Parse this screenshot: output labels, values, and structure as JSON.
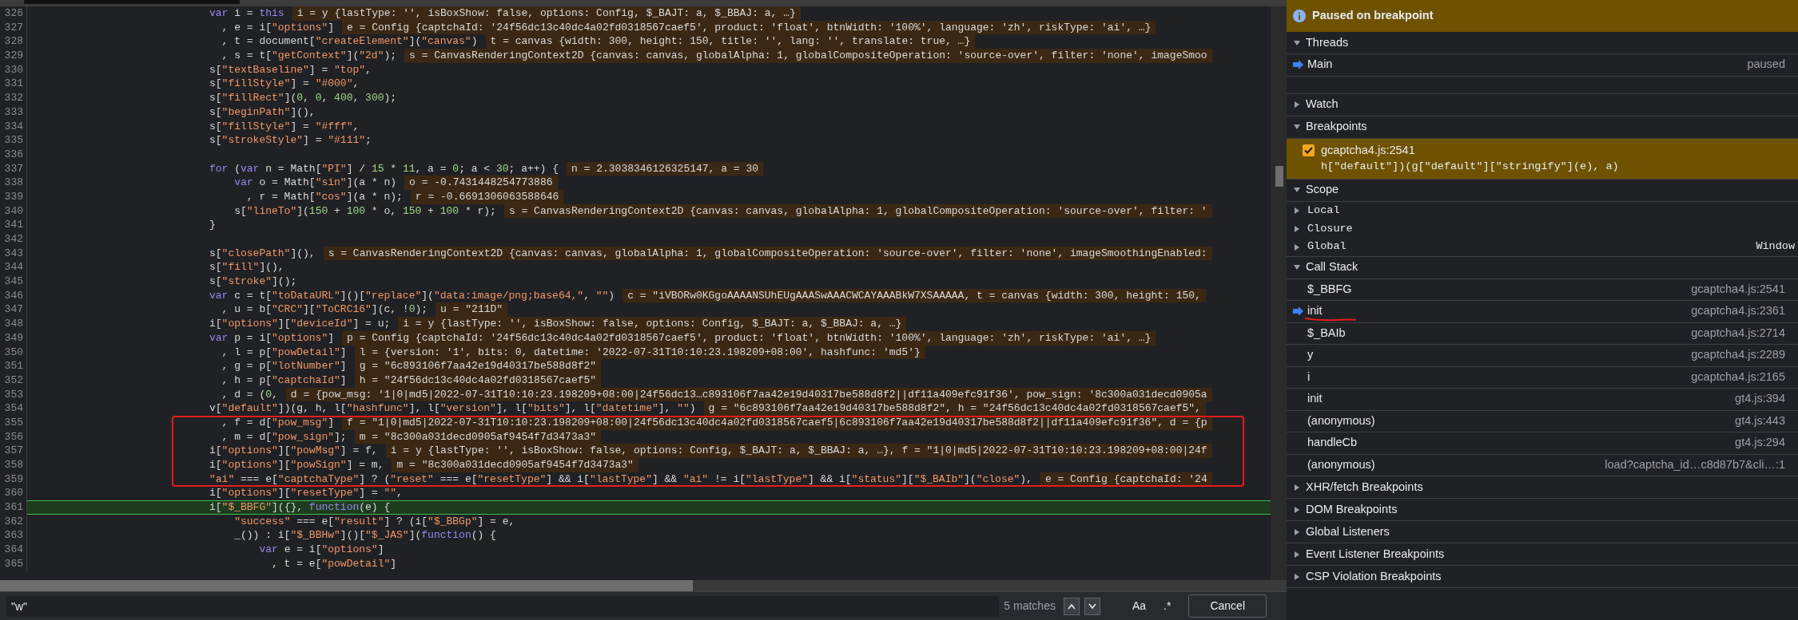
{
  "editor": {
    "lines": [
      {
        "number": "326",
        "code": "var i = this",
        "value": "i = y {lastType: '', isBoxShow: false, options: Config, $_BAJT: a, $_BBAJ: a, …}",
        "current": false
      },
      {
        "number": "327",
        "code": "  , e = i[\"options\"]",
        "value": "e = Config {captchaId: '24f56dc13c40dc4a02fd0318567caef5', product: 'float', btnWidth: '100%', language: 'zh', riskType: 'ai', …}",
        "current": false
      },
      {
        "number": "328",
        "code": "  , t = document[\"createElement\"](\"canvas\")",
        "value": "t = canvas {width: 300, height: 150, title: '', lang: '', translate: true, …}",
        "current": false
      },
      {
        "number": "329",
        "code": "  , s = t[\"getContext\"](\"2d\");",
        "value": "s = CanvasRenderingContext2D {canvas: canvas, globalAlpha: 1, globalCompositeOperation: 'source-over', filter: 'none', imageSmoo",
        "current": false
      },
      {
        "number": "330",
        "code": "s[\"textBaseline\"] = \"top\",",
        "current": false
      },
      {
        "number": "331",
        "code": "s[\"fillStyle\"] = \"#000\",",
        "current": false
      },
      {
        "number": "332",
        "code": "s[\"fillRect\"](0, 0, 400, 300);",
        "current": false
      },
      {
        "number": "333",
        "code": "s[\"beginPath\"](),",
        "current": false
      },
      {
        "number": "334",
        "code": "s[\"fillStyle\"] = \"#fff\",",
        "current": false
      },
      {
        "number": "335",
        "code": "s[\"strokeStyle\"] = \"#111\";",
        "current": false
      },
      {
        "number": "336",
        "current": false
      },
      {
        "number": "337",
        "code": "for (var n = Math[\"PI\"] / 15 * 11, a = 0; a < 30; a++) {",
        "value": "n = 2.3038346126325147, a = 30",
        "current": false
      },
      {
        "number": "338",
        "code": "    var o = Math[\"sin\"](a * n)",
        "value": "o = -0.7431448254773886",
        "current": false
      },
      {
        "number": "339",
        "code": "      , r = Math[\"cos\"](a * n);",
        "value": "r = -0.6691306063588646",
        "current": false
      },
      {
        "number": "340",
        "code": "    s[\"lineTo\"](150 + 100 * o, 150 + 100 * r);",
        "value": "s = CanvasRenderingContext2D {canvas: canvas, globalAlpha: 1, globalCompositeOperation: 'source-over', filter: '",
        "current": false
      },
      {
        "number": "341",
        "code": "}",
        "current": false
      },
      {
        "number": "342",
        "current": false
      },
      {
        "number": "343",
        "code": "s[\"closePath\"](),",
        "value": "s = CanvasRenderingContext2D {canvas: canvas, globalAlpha: 1, globalCompositeOperation: 'source-over', filter: 'none', imageSmoothingEnabled:",
        "current": false
      },
      {
        "number": "344",
        "code": "s[\"fill\"](),",
        "current": false
      },
      {
        "number": "345",
        "code": "s[\"stroke\"]();",
        "current": false
      },
      {
        "number": "346",
        "code": "var c = t[\"toDataURL\"]()[\"replace\"](\"data:image/png;base64,\", \"\")",
        "value": "c = \"iVBORw0KGgoAAAANSUhEUgAAASwAAACWCAYAAABkW7XSAAAAA, t = canvas {width: 300, height: 150,",
        "current": false
      },
      {
        "number": "347",
        "code": "  , u = b[\"CRC\"][\"ToCRC16\"](c, !0);",
        "value": "u = \"211D\"",
        "current": false
      },
      {
        "number": "348",
        "code": "i[\"options\"][\"deviceId\"] = u;",
        "value": "i = y {lastType: '', isBoxShow: false, options: Config, $_BAJT: a, $_BBAJ: a, …}",
        "current": false
      },
      {
        "number": "349",
        "code": "var p = i[\"options\"]",
        "value": "p = Config {captchaId: '24f56dc13c40dc4a02fd0318567caef5', product: 'float', btnWidth: '100%', language: 'zh', riskType: 'ai', …}",
        "current": false
      },
      {
        "number": "350",
        "code": "  , l = p[\"powDetail\"]",
        "value": "l = {version: '1', bits: 0, datetime: '2022-07-31T10:10:23.198209+08:00', hashfunc: 'md5'}",
        "current": false
      },
      {
        "number": "351",
        "code": "  , g = p[\"lotNumber\"]",
        "value": "g = \"6c893106f7aa42e19d40317be588d8f2\"",
        "current": false
      },
      {
        "number": "352",
        "code": "  , h = p[\"captchaId\"]",
        "value": "h = \"24f56dc13c40dc4a02fd0318567caef5\"",
        "current": false
      },
      {
        "number": "353",
        "code": "  , d = (0,",
        "value": "d = {pow_msg: '1|0|md5|2022-07-31T10:10:23.198209+08:00|24f56dc13…c893106f7aa42e19d40317be588d8f2||df11a409efc91f36', pow_sign: '8c300a031decd0905a",
        "current": false
      },
      {
        "number": "354",
        "code": "v[\"default\"])(g, h, l[\"hashfunc\"], l[\"version\"], l[\"bits\"], l[\"datetime\"], \"\")",
        "value": "g = \"6c893106f7aa42e19d40317be588d8f2\", h = \"24f56dc13c40dc4a02fd0318567caef5\",",
        "current": false
      },
      {
        "number": "355",
        "code": "  , f = d[\"pow_msg\"]",
        "value": "f = \"1|0|md5|2022-07-31T10:10:23.198209+08:00|24f56dc13c40dc4a02fd0318567caef5|6c893106f7aa42e19d40317be588d8f2||df11a409efc91f36\", d = {p",
        "current": false
      },
      {
        "number": "356",
        "code": "  , m = d[\"pow_sign\"];",
        "value": "m = \"8c300a031decd0905af9454f7d3473a3\"",
        "current": false
      },
      {
        "number": "357",
        "code": "i[\"options\"][\"powMsg\"] = f,",
        "value": "i = y {lastType: '', isBoxShow: false, options: Config, $_BAJT: a, $_BBAJ: a, …}, f = \"1|0|md5|2022-07-31T10:10:23.198209+08:00|24f",
        "current": false
      },
      {
        "number": "358",
        "code": "i[\"options\"][\"powSign\"] = m,",
        "value": "m = \"8c300a031decd0905af9454f7d3473a3\"",
        "current": false
      },
      {
        "number": "359",
        "code": "\"ai\" === e[\"captchaType\"] ? (\"reset\" === e[\"resetType\"] && i[\"lastType\"] && \"ai\" != i[\"lastType\"] && i[\"status\"][\"$_BAIb\"](\"close\"),",
        "value": "e = Config {captchaId: '24",
        "current": false
      },
      {
        "number": "360",
        "code": "i[\"options\"][\"resetType\"] = \"\",",
        "current": false
      },
      {
        "number": "361",
        "code": "i[\"$_BBFG\"]({}, function(e) {",
        "current": true
      },
      {
        "number": "362",
        "code": "    \"success\" === e[\"result\"] ? (i[\"$_BBGp\"] = e,",
        "current": false
      },
      {
        "number": "363",
        "code": "    _()) : i[\"$_BBHw\"]()[\"$_JAS\"](function() {",
        "current": false
      },
      {
        "number": "364",
        "code": "        var e = i[\"options\"]",
        "current": false
      },
      {
        "number": "365",
        "code": "          , t = e[\"powDetail\"]",
        "current": false
      }
    ],
    "search": {
      "value": "\"w\"",
      "matches": "5 matches",
      "case_button": "Aa",
      "regex_button": ".*",
      "cancel_button": "Cancel"
    }
  },
  "debugger": {
    "banner": "Paused on breakpoint",
    "sections": [
      {
        "kind": "threads",
        "title": "Threads",
        "expanded": true,
        "items": [
          {
            "name": "Main",
            "status": "paused",
            "selected": true
          }
        ]
      },
      {
        "title": "Watch",
        "expanded": false
      },
      {
        "kind": "breakpoints",
        "title": "Breakpoints",
        "expanded": true,
        "items": [
          {
            "location": "gcaptcha4.js:2541",
            "code": "h[\"default\"])(g[\"default\"][\"stringify\"](e), a)",
            "checked": true,
            "hit": true
          }
        ]
      },
      {
        "kind": "scope",
        "title": "Scope",
        "expanded": true,
        "items": [
          {
            "name": "Local",
            "expanded": false
          },
          {
            "name": "Closure",
            "expanded": false
          },
          {
            "name": "Global",
            "value": "Window",
            "expanded": false
          }
        ]
      },
      {
        "kind": "call_stack",
        "title": "Call Stack",
        "expanded": true,
        "items": [
          {
            "name": "$_BBFG",
            "location": "gcaptcha4.js:2541",
            "selected": false
          },
          {
            "name": "init",
            "location": "gcaptcha4.js:2361",
            "selected": true
          },
          {
            "name": "$_BAIb",
            "location": "gcaptcha4.js:2714",
            "selected": false
          },
          {
            "name": "y",
            "location": "gcaptcha4.js:2289",
            "selected": false
          },
          {
            "name": "i",
            "location": "gcaptcha4.js:2165",
            "selected": false
          },
          {
            "name": "init",
            "location": "gt4.js:394",
            "selected": false
          },
          {
            "name": "(anonymous)",
            "location": "gt4.js:443",
            "selected": false
          },
          {
            "name": "handleCb",
            "location": "gt4.js:294",
            "selected": false
          },
          {
            "name": "(anonymous)",
            "location": "load?captcha_id…c8d87b7&cli…:1",
            "selected": false
          }
        ]
      },
      {
        "title": "XHR/fetch Breakpoints",
        "expanded": false
      },
      {
        "title": "DOM Breakpoints",
        "expanded": false
      },
      {
        "title": "Global Listeners",
        "expanded": false
      },
      {
        "title": "Event Listener Breakpoints",
        "expanded": false
      },
      {
        "title": "CSP Violation Breakpoints",
        "expanded": false
      }
    ]
  }
}
